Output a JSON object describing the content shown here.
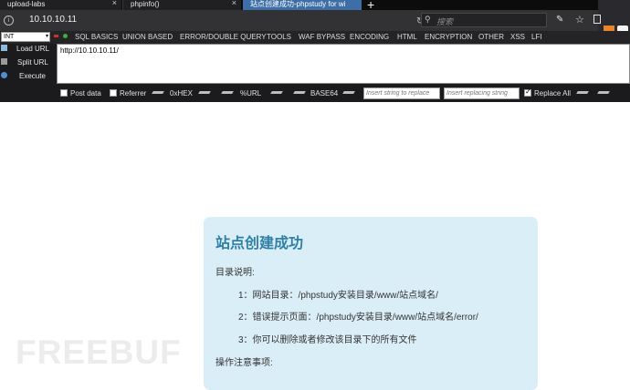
{
  "tabs": [
    {
      "title": "upload-labs",
      "close": "×"
    },
    {
      "title": "phpinfo()",
      "close": "×"
    },
    {
      "title": "站点创建成功-phpstudy for wi",
      "close": "×"
    }
  ],
  "new_tab": "+",
  "navbar": {
    "url": "10.10.10.11",
    "search_placeholder": "搜索"
  },
  "hackbar": {
    "int_select": "INT",
    "menu": [
      "SQL BASICS",
      "UNION BASED",
      "ERROR/DOUBLE QUERY",
      "TOOLS",
      "WAF BYPASS",
      "ENCODING",
      "HTML",
      "ENCRYPTION",
      "OTHER",
      "XSS",
      "LFI"
    ],
    "load_url": "Load URL",
    "split_url": "Split URL",
    "execute": "Execute",
    "url_value": "http://10.10.10.11/",
    "post_data": "Post data",
    "referrer": "Referrer",
    "hex": "0xHEX",
    "url_enc": "%URL",
    "base64": "BASE64",
    "insert_placeholder": "Insert string to replace",
    "replacing_placeholder": "Insert replacing string",
    "replace_all": "Replace All"
  },
  "page": {
    "title": "站点创建成功",
    "dir_label": "目录说明:",
    "item1": "1：网站目录：/phpstudy安装目录/www/站点域名/",
    "item2": "2：错误提示页面：/phpstudy安装目录/www/站点域名/error/",
    "item3": "3：你可以删除或者修改该目录下的所有文件",
    "notes_label": "操作注意事项:"
  },
  "watermark": "FREEBUF"
}
